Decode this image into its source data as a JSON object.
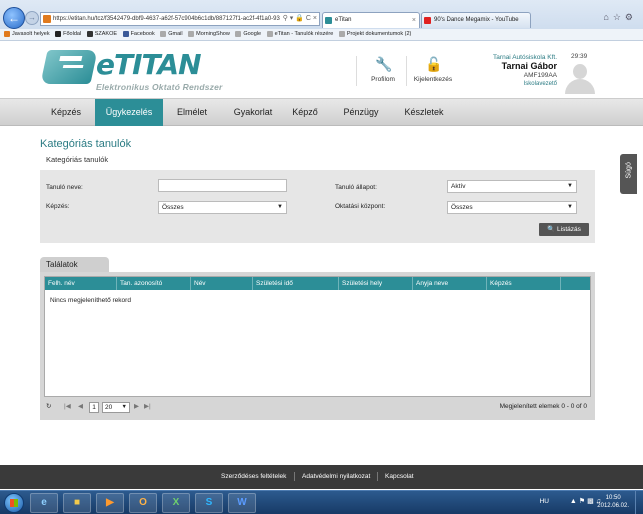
{
  "browser": {
    "url": "https://etitan.hu/tcz/f3542479-dbf9-4637-a62f-57c904b6c1db/887127f1-ac2f-4f1a0-93",
    "tabs": [
      {
        "label": "eTitan",
        "active": true,
        "icon_color": "#2c8e97"
      },
      {
        "label": "90's Dance Megamix - YouTube",
        "active": false,
        "icon_color": "#e02020"
      }
    ],
    "favorites": [
      {
        "label": "Javasolt helyek",
        "icon_color": "#e07a1e"
      },
      {
        "label": "Főoldal",
        "icon_color": "#222222"
      },
      {
        "label": "SZAKOE",
        "icon_color": "#333333"
      },
      {
        "label": "Facebook",
        "icon_color": "#3b5998"
      },
      {
        "label": "Gmail",
        "icon_color": "#aaaaaa"
      },
      {
        "label": "MorningShow",
        "icon_color": "#aaaaaa"
      },
      {
        "label": "Google",
        "icon_color": "#aaaaaa"
      },
      {
        "label": "eTitan - Tanulók részére",
        "icon_color": "#aaaaaa"
      },
      {
        "label": "Projekt dokumentumok (2)",
        "icon_color": "#aaaaaa"
      }
    ]
  },
  "header": {
    "logo_title": "eTITAN",
    "logo_subtitle": "Elektronikus Oktató Rendszer",
    "profile_label": "Profilom",
    "logout_label": "Kijelentkezés",
    "school": "Tarnai Autósiskola Kft.",
    "user_name": "Tarnai Gábor",
    "user_code": "AMF199AA",
    "user_role": "Iskolavezető",
    "clock": "29:39"
  },
  "nav": {
    "items": [
      "Képzés",
      "Ügykezelés",
      "Elmélet",
      "Gyakorlat",
      "Képző",
      "Pénzügy",
      "Készletek"
    ],
    "active": "Ügykezelés"
  },
  "side_tab": "Súgó",
  "page": {
    "title": "Kategóriás tanulók",
    "subtitle": "Kategóriás tanulók"
  },
  "filters": {
    "student_name_label": "Tanuló neve:",
    "student_name_value": "",
    "training_label": "Képzés:",
    "training_value": "Összes",
    "student_status_label": "Tanuló állapot:",
    "student_status_value": "Aktív",
    "center_label": "Oktatási központ:",
    "center_value": "Összes",
    "search_button": "Listázás"
  },
  "results": {
    "tab_label": "Találatok",
    "columns": [
      "Felh. név",
      "Tan. azonosító",
      "Név",
      "Születési idő",
      "Születési hely",
      "Anyja neve",
      "Képzés"
    ],
    "empty_message": "Nincs megjeleníthető rekord",
    "pager": {
      "page": "1",
      "page_size": "20",
      "summary": "Megjelenített elemek 0 - 0 of 0"
    }
  },
  "footer": {
    "links": [
      "Szerződéses feltételek",
      "Adatvédelmi nyilatkozat",
      "Kapcsolat"
    ]
  },
  "taskbar": {
    "language": "HU",
    "time": "10:50",
    "date": "2012.06.02."
  }
}
